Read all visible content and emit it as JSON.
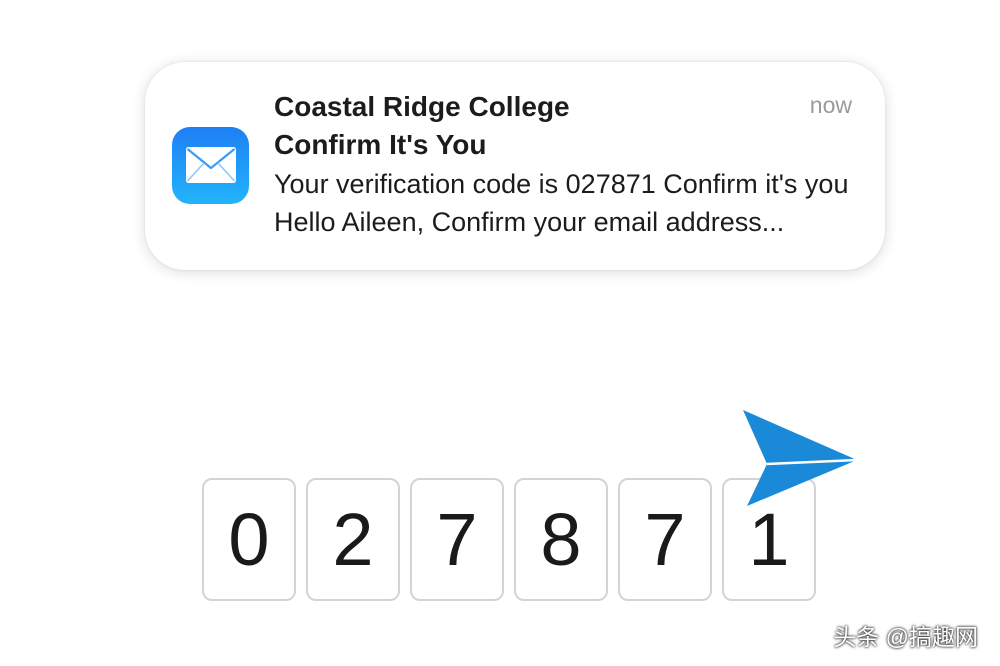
{
  "notification": {
    "app_icon": "mail-icon",
    "sender": "Coastal Ridge College",
    "subject": "Confirm It's You",
    "preview": "Your verification code is 027871 Confirm it's you Hello Aileen, Confirm your email address...",
    "timestamp": "now"
  },
  "code": {
    "digits": [
      "0",
      "2",
      "7",
      "8",
      "7",
      "1"
    ]
  },
  "decoration": {
    "icon": "paper-plane-icon",
    "color": "#1a8ad8"
  },
  "watermark": {
    "text": "头条 @搞趣网"
  }
}
